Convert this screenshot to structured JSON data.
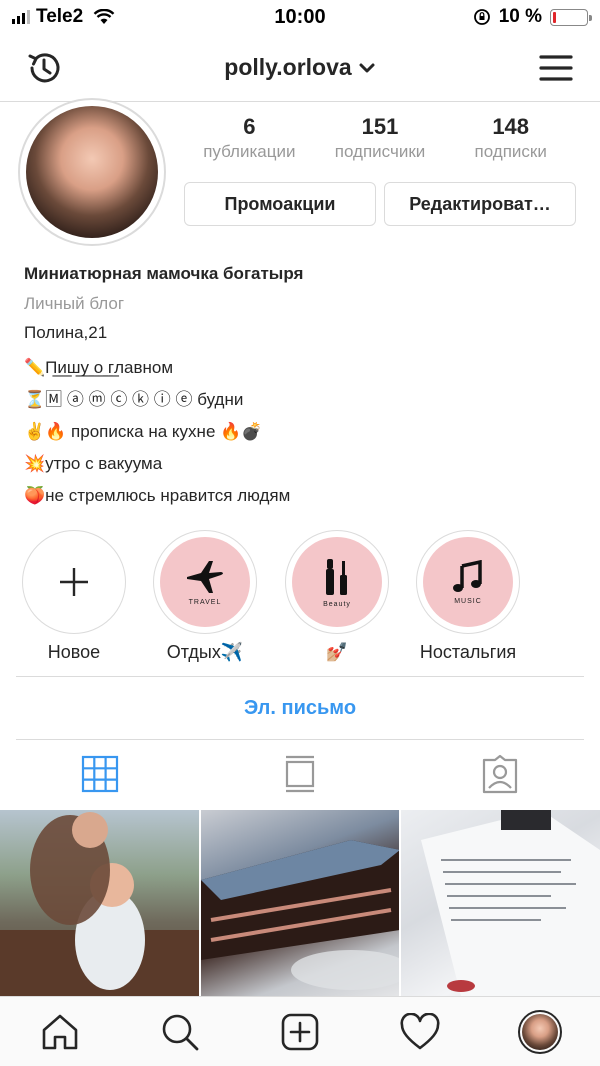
{
  "status_bar": {
    "carrier": "Tele2",
    "time": "10:00",
    "battery_percent": "10 %",
    "battery_level": 0.1,
    "battery_color": "#e0262b"
  },
  "header": {
    "username": "polly.orlova"
  },
  "stats": [
    {
      "value": "6",
      "label": "публикации"
    },
    {
      "value": "151",
      "label": "подписчики"
    },
    {
      "value": "148",
      "label": "подписки"
    }
  ],
  "buttons": {
    "promo": "Промоакции",
    "edit": "Редактироват…"
  },
  "bio": {
    "name": "Миниатюрная мамочка богатыря",
    "category": "Личный блог",
    "lines": [
      "Полина,21",
      "✏️П̲и̲ш̲у̲ ̲о̲ ̲г̲лавном",
      "⏳🄼 ⓐ ⓜ ⓒ ⓚ ⓘ ⓔ будни",
      "✌️🔥 прописка на кухне 🔥💣",
      "💥утро с вакуума",
      "🍑не стремлюсь нравится людям"
    ]
  },
  "highlights": [
    {
      "label": "Новое",
      "icon": "plus-icon",
      "inner_text": ""
    },
    {
      "label": "Отдых✈️",
      "icon": "airplane-icon",
      "inner_text": "TRAVEL"
    },
    {
      "label": "💅🏼",
      "icon": "cosmetics-icon",
      "inner_text": "Beauty"
    },
    {
      "label": "Ностальгия",
      "icon": "music-note-icon",
      "inner_text": "MUSIC"
    }
  ],
  "email_button": "Эл. письмо",
  "tabs": [
    {
      "icon": "grid-icon",
      "active": true
    },
    {
      "icon": "feed-icon",
      "active": false
    },
    {
      "icon": "tagged-icon",
      "active": false
    }
  ],
  "colors": {
    "accent": "#3897f0",
    "highlight_fill": "#f4c6c9",
    "border": "#dbdbdb",
    "text": "#262626",
    "muted": "#999999"
  },
  "bottom_nav": [
    {
      "icon": "home-icon"
    },
    {
      "icon": "search-icon"
    },
    {
      "icon": "add-post-icon"
    },
    {
      "icon": "heart-icon"
    },
    {
      "icon": "profile-avatar"
    }
  ]
}
